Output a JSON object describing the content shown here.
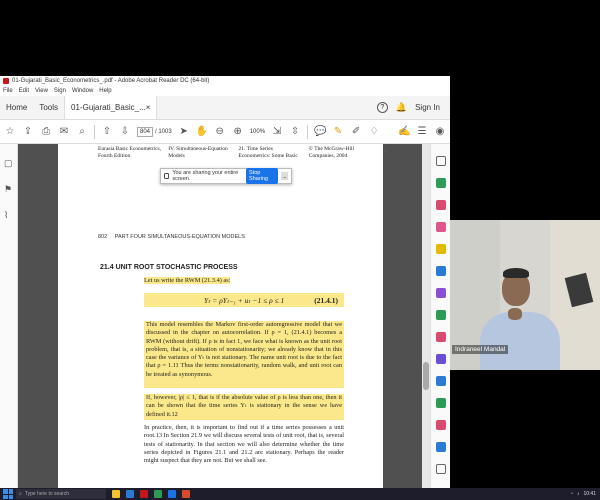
{
  "window": {
    "title": "01-Gujarati_Basic_Econometrics_.pdf - Adobe Acrobat Reader DC (64-bit)"
  },
  "menubar": [
    "File",
    "Edit",
    "View",
    "Sign",
    "Window",
    "Help"
  ],
  "tabs": {
    "home": "Home",
    "tools": "Tools",
    "document": "01-Gujarati_Basic_...",
    "sign_in": "Sign In"
  },
  "toolbar": {
    "current_page": "804",
    "total_pages": "/ 1003",
    "zoom": "100%"
  },
  "share_bar": {
    "message": "You are sharing your entire screen.",
    "stop_label": "Stop Sharing",
    "hide_label": "_"
  },
  "document": {
    "ref_row": [
      "Eurasia Basic Econometrics, Fourth Edition",
      "IV. Simultaneous-Equation Models",
      "21. Time Series Econometrics: Some Basic",
      "© The McGraw-Hill Companies, 2004"
    ],
    "page_number": "802",
    "running_head": "PART FOUR   SIMULTANEOUS-EQUATION MODELS",
    "section_heading": "21.4   UNIT ROOT STOCHASTIC PROCESS",
    "intro_line": "Let us write the RWM (21.3.4) as:",
    "equation": "Yₜ = ρYₜ₋₁ + uₜ       −1 ≤ ρ ≤ 1",
    "equation_number": "(21.4.1)",
    "paragraph1": "This model resembles the Markov first-order autoregressive model that we discussed in the chapter on autocorrelation. If ρ = 1, (21.4.1) becomes a RWM (without drift). If ρ is in fact 1, we face what is known as the unit root problem, that is, a situation of nonstationarity; we already know that in this case the variance of Yₜ is not stationary. The name unit root is due to the fact that ρ = 1.11 Thus the terms nonstationarity, random walk, and unit root can be treated as synonymous.",
    "paragraph2": "If, however, |ρ| ≤ 1, that is if the absolute value of ρ is less than one, then it can be shown that the time series Yₜ is stationary in the sense we have defined it.12",
    "paragraph3": "In practice, then, it is important to find out if a time series possesses a unit root.13 In Section 21.9 we will discuss several tests of unit root, that is, several tests of stationarity. In that section we will also determine whether the time series depicted in Figures 21.1 and 21.2 are stationary. Perhaps the reader might suspect that they are not. But we shall see."
  },
  "webcam": {
    "participant_name": "Indraneel Mandal"
  },
  "taskbar": {
    "search_placeholder": "Type here to search",
    "clock": "10:41"
  }
}
